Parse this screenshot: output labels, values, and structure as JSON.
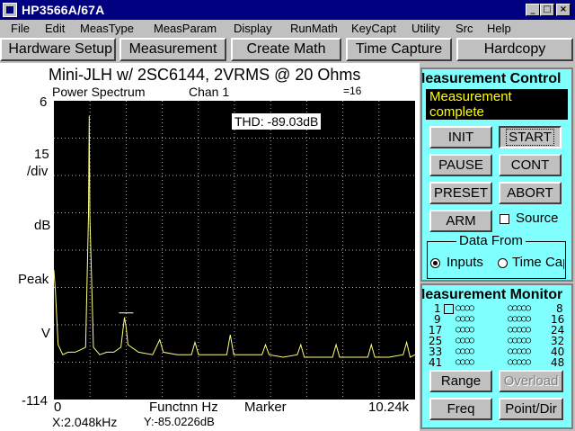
{
  "window": {
    "title": "HP3566A/67A",
    "minimize": "_",
    "maximize": "□",
    "close": "×"
  },
  "menu": [
    "File",
    "Edit",
    "MeasType",
    "MeasParam",
    "Display",
    "RunMath",
    "KeyCapt",
    "Utility",
    "Src",
    "Help"
  ],
  "toolbar": [
    "Hardware Setup",
    "Measurement",
    "Create Math",
    "Time Capture",
    "Hardcopy"
  ],
  "plot": {
    "title": "Mini-JLH w/ 2SC6144, 2VRMS @ 20 Ohms",
    "mode": "Power Spectrum",
    "channel": "Chan 1",
    "avg": "=16",
    "y_top": "6",
    "y_scale": "15",
    "y_div": "/div",
    "y_unit": "dB",
    "y_peak": "Peak",
    "y_v": "V",
    "y_bottom": "-114",
    "x_start": "0",
    "x_label": "Functnn Hz",
    "marker": "Marker",
    "x_end": "10.24k",
    "thd": "THD:  -89.03dB",
    "readout_x": "X:2.048kHz",
    "readout_y": "Y:-85.0226dB",
    "trace_color": "#ffff80"
  },
  "chart_data": {
    "type": "line",
    "title": "Mini-JLH w/ 2SC6144, 2VRMS @ 20 Ohms",
    "xlabel": "Functnn Hz",
    "ylabel": "dB",
    "xlim": [
      0,
      10240
    ],
    "ylim": [
      -114,
      6
    ],
    "grid": true,
    "series": [
      {
        "points": [
          [
            0,
            -62
          ],
          [
            40,
            -70
          ],
          [
            120,
            -92
          ],
          [
            250,
            -96
          ],
          [
            400,
            -95
          ],
          [
            600,
            -95
          ],
          [
            760,
            -94
          ],
          [
            900,
            -93
          ],
          [
            980,
            -40
          ],
          [
            1000,
            0
          ],
          [
            1020,
            -40
          ],
          [
            1120,
            -93
          ],
          [
            1300,
            -96
          ],
          [
            1500,
            -95
          ],
          [
            1700,
            -95
          ],
          [
            1900,
            -93
          ],
          [
            2000,
            -81
          ],
          [
            2048,
            -85
          ],
          [
            2100,
            -92
          ],
          [
            2400,
            -95
          ],
          [
            2800,
            -96
          ],
          [
            3000,
            -90
          ],
          [
            3100,
            -95
          ],
          [
            3500,
            -96
          ],
          [
            3900,
            -96
          ],
          [
            4000,
            -91
          ],
          [
            4100,
            -96
          ],
          [
            4500,
            -96
          ],
          [
            4900,
            -96
          ],
          [
            5000,
            -88
          ],
          [
            5100,
            -96
          ],
          [
            5500,
            -96
          ],
          [
            5900,
            -96
          ],
          [
            6000,
            -92
          ],
          [
            6100,
            -96
          ],
          [
            6500,
            -97
          ],
          [
            6900,
            -96
          ],
          [
            7000,
            -92
          ],
          [
            7100,
            -97
          ],
          [
            7500,
            -97
          ],
          [
            7900,
            -97
          ],
          [
            8000,
            -92
          ],
          [
            8100,
            -97
          ],
          [
            8500,
            -97
          ],
          [
            8900,
            -97
          ],
          [
            9000,
            -92
          ],
          [
            9100,
            -97
          ],
          [
            9500,
            -97
          ],
          [
            9900,
            -96
          ],
          [
            10000,
            -91
          ],
          [
            10100,
            -97
          ],
          [
            10240,
            -96
          ]
        ]
      }
    ]
  },
  "control": {
    "header": "Measurement Control",
    "status": "Measurement complete",
    "buttons": [
      "INIT",
      "START",
      "PAUSE",
      "CONT",
      "PRESET",
      "ABORT",
      "ARM"
    ],
    "source_label": "Source",
    "data_from": "Data From",
    "radio_inputs": "Inputs",
    "radio_time": "Time Capture"
  },
  "monitor": {
    "header": "Measurement Monitor",
    "rows": [
      {
        "start": "1",
        "end": "8"
      },
      {
        "start": "9",
        "end": "16"
      },
      {
        "start": "17",
        "end": "24"
      },
      {
        "start": "25",
        "end": "32"
      },
      {
        "start": "33",
        "end": "40"
      },
      {
        "start": "41",
        "end": "48"
      }
    ],
    "dots_left": "○○○○",
    "dots_right": "○○○○○",
    "buttons": [
      "Range",
      "Overload",
      "Freq",
      "Point/Dir"
    ]
  }
}
